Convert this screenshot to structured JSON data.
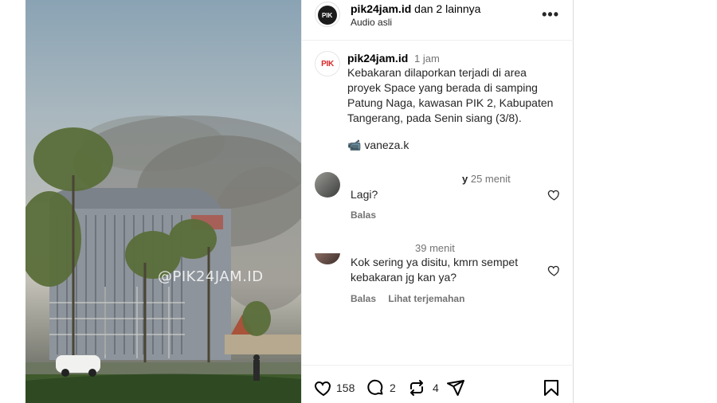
{
  "media": {
    "watermark": "@PIK24JAM.ID"
  },
  "header": {
    "username": "pik24jam.id",
    "collab": " dan 2 lainnya",
    "subtitle": "Audio asli",
    "avatar_text": "PIK",
    "more_icon": "more-horizontal-icon"
  },
  "post": {
    "avatar_text": "PIK",
    "username": "pik24jam.id",
    "time": "1 jam",
    "caption": "Kebakaran dilaporkan terjadi di area proyek Space yang berada di samping Patung Naga, kawasan PIK 2, Kabupaten Tangerang, pada Senin siang (3/8).",
    "credit_icon": "camera-emoji-icon",
    "credit": "vaneza.k"
  },
  "comments": [
    {
      "user": "y",
      "time": "25 menit",
      "text": "Lagi?",
      "reply": "Balas"
    },
    {
      "user": "",
      "time": "39 menit",
      "text": "Kok sering ya disitu, kmrn sempet kebakaran jg kan ya?",
      "reply": "Balas",
      "translate": "Lihat terjemahan"
    }
  ],
  "actions": {
    "likes": "158",
    "comments": "2",
    "reposts": "4",
    "icons": [
      "heart-icon",
      "comment-icon",
      "repost-icon",
      "share-icon",
      "bookmark-icon"
    ]
  }
}
